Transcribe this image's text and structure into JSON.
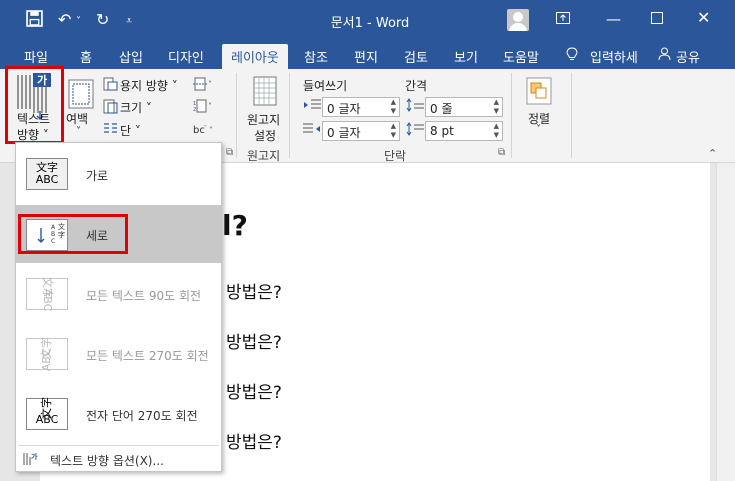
{
  "titlebar": {
    "title": "문서1 - Word",
    "save_icon": "save-icon",
    "undo_icon": "undo-icon",
    "redo_icon": "redo-icon",
    "customize_icon": "customize-quick-access-icon",
    "ribbon_display_icon": "ribbon-display-options-icon",
    "minimize_icon": "minimize-icon",
    "restore_icon": "restore-icon",
    "close_icon": "close-icon",
    "colors": {
      "bar": "#2b579a"
    }
  },
  "tabs": [
    "파일",
    "홈",
    "삽입",
    "디자인",
    "레이아웃",
    "참조",
    "편지",
    "검토",
    "보기",
    "도움말"
  ],
  "active_tab": "레이아웃",
  "tell_me": "입력하세",
  "share": "공유",
  "ribbon": {
    "text_direction": [
      "텍스트",
      "방향 ˅"
    ],
    "margins": "여백",
    "orientation": "용지 방향 ˅",
    "size": "크기 ˅",
    "columns": "단 ˅",
    "manuscript": [
      "원고지",
      "설정"
    ],
    "manuscript_group": "원고지",
    "indent_label": "들여쓰기",
    "spacing_label": "간격",
    "indent_left": "0 글자",
    "indent_right": "0 글자",
    "spacing_before": "0 줄",
    "spacing_after": "8 pt",
    "paragraph_group": "단락",
    "arrange": "정렬"
  },
  "dropdown": {
    "items": [
      {
        "label": "가로",
        "icon": [
          "文字",
          "ABC"
        ],
        "enabled": true,
        "selected": false
      },
      {
        "label": "세로",
        "icon": [
          "文字",
          "ABC"
        ],
        "enabled": true,
        "selected": true
      },
      {
        "label": "모든 텍스트 90도 회전",
        "icon": [
          "文字",
          "ABC"
        ],
        "enabled": false,
        "selected": false
      },
      {
        "label": "모든 텍스트 270도 회전",
        "icon": [
          "文字",
          "ABC"
        ],
        "enabled": false,
        "selected": false
      },
      {
        "label": "전자 단어 270도 회전",
        "icon": [
          "文字",
          "ABC"
        ],
        "enabled": true,
        "selected": false
      }
    ],
    "options": "텍스트 방향 옵션(X)..."
  },
  "document": {
    "heading": "l?",
    "lines": [
      "방법은?",
      "방법은?",
      "방법은?",
      "방법은?"
    ]
  },
  "highlight_color": "#e00000"
}
